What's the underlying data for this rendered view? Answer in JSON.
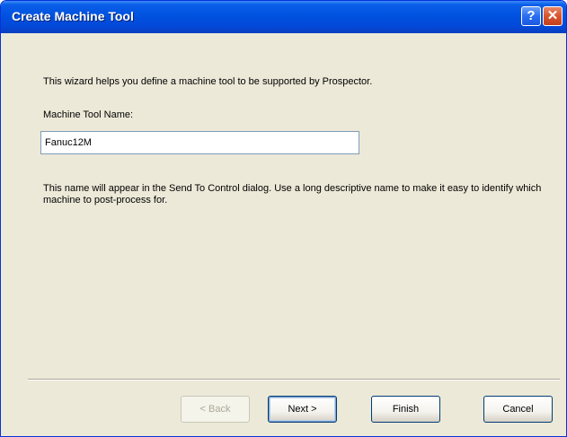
{
  "window": {
    "title": "Create Machine Tool",
    "help_glyph": "?",
    "close_glyph": "✕"
  },
  "wizard": {
    "intro": "This wizard helps you define a machine tool to be supported by Prospector.",
    "name_label": "Machine Tool Name:",
    "name_value": "Fanuc12M",
    "hint": "This name will appear in the Send To Control dialog.  Use a long descriptive name to make it easy to identify which machine to post-process for."
  },
  "buttons": {
    "back": "< Back",
    "next": "Next >",
    "finish": "Finish",
    "cancel": "Cancel"
  },
  "icons": {
    "help": "help-icon",
    "close": "close-icon"
  },
  "colors": {
    "titlebar": "#0052e0",
    "dialog_bg": "#ece9d8",
    "close_button": "#d8552e"
  }
}
